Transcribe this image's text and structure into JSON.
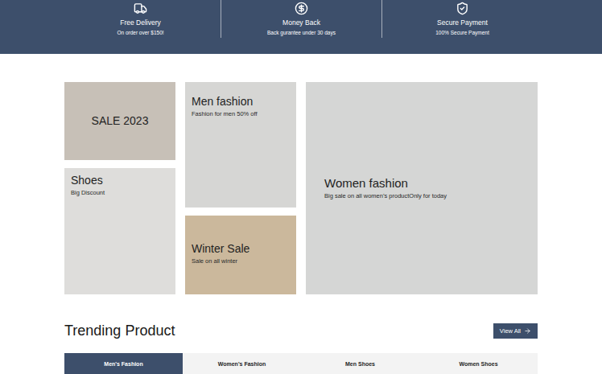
{
  "features": [
    {
      "icon": "truck",
      "title": "Free Delivery",
      "subtitle": "On order over $150!"
    },
    {
      "icon": "dollar",
      "title": "Money Back",
      "subtitle": "Back gurantee under 30 days"
    },
    {
      "icon": "shield",
      "title": "Secure Payment",
      "subtitle": "100% Secure Payment"
    }
  ],
  "banners": {
    "sale": {
      "title": "SALE 2023"
    },
    "men": {
      "title": "Men fashion",
      "subtitle": "Fashion for men 50% off"
    },
    "shoes": {
      "title": "Shoes",
      "subtitle": "Big Discount"
    },
    "winter": {
      "title": "Winter Sale",
      "subtitle": "Sale on all winter"
    },
    "women": {
      "title": "Women fashion",
      "subtitle": "Big sale on all women’s productOnly for today"
    }
  },
  "trending": {
    "title": "Trending Product",
    "view_all": "View All",
    "tabs": [
      {
        "label": "Men's Fashion",
        "selected": true
      },
      {
        "label": "Women's Fashion",
        "selected": false
      },
      {
        "label": "Men Shoes",
        "selected": false
      },
      {
        "label": "Women Shoes",
        "selected": false
      }
    ]
  }
}
